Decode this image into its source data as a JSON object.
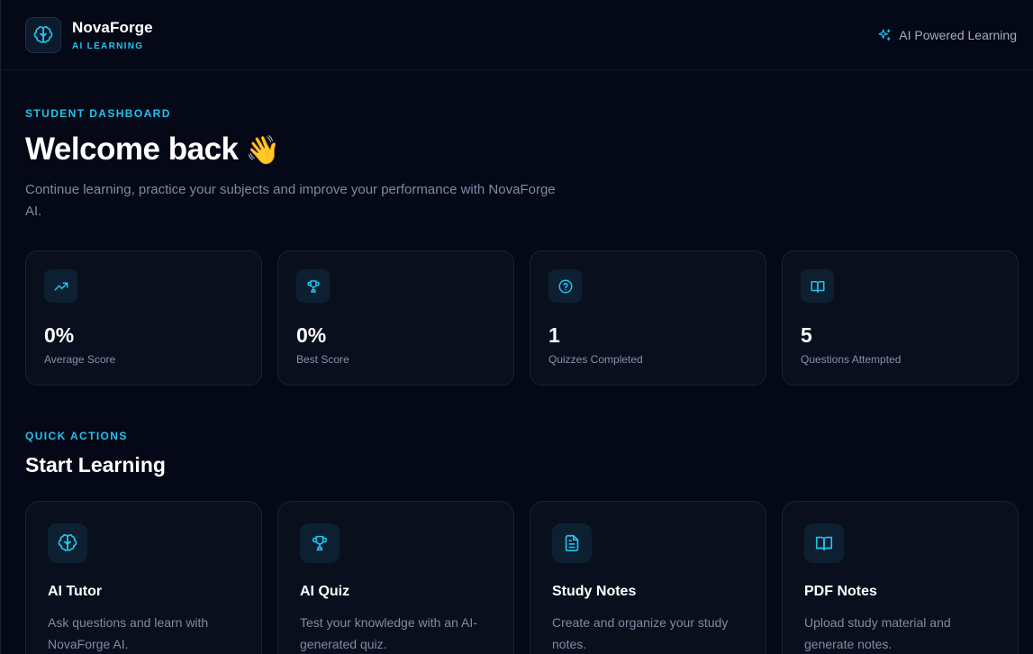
{
  "header": {
    "brand_name": "NovaForge",
    "brand_sub": "AI LEARNING",
    "right_label": "AI Powered Learning",
    "logo_icon": "brain-icon",
    "right_icon": "sparkles-icon"
  },
  "hero": {
    "eyebrow": "STUDENT DASHBOARD",
    "title": "Welcome back",
    "emoji": "👋",
    "subtitle": "Continue learning, practice your subjects and improve your performance with NovaForge AI."
  },
  "stats": [
    {
      "icon": "trending-up-icon",
      "value": "0%",
      "label": "Average Score"
    },
    {
      "icon": "trophy-icon",
      "value": "0%",
      "label": "Best Score"
    },
    {
      "icon": "question-circle-icon",
      "value": "1",
      "label": "Quizzes Completed"
    },
    {
      "icon": "book-open-icon",
      "value": "5",
      "label": "Questions Attempted"
    }
  ],
  "quick_actions": {
    "eyebrow": "QUICK ACTIONS",
    "title": "Start Learning",
    "items": [
      {
        "icon": "brain-icon",
        "title": "AI Tutor",
        "desc": "Ask questions and learn with NovaForge AI."
      },
      {
        "icon": "trophy-icon",
        "title": "AI Quiz",
        "desc": "Test your knowledge with an AI-generated quiz."
      },
      {
        "icon": "file-text-icon",
        "title": "Study Notes",
        "desc": "Create and organize your study notes."
      },
      {
        "icon": "book-open-icon",
        "title": "PDF Notes",
        "desc": "Upload study material and generate notes."
      }
    ]
  },
  "colors": {
    "background": "#050816",
    "accent": "#22c3ee",
    "card": "#0a0f1e",
    "muted_text": "#7f8aa3"
  }
}
